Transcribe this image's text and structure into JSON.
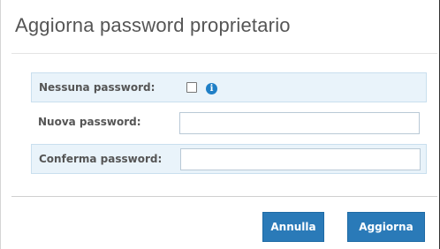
{
  "dialog": {
    "title": "Aggiorna password proprietario"
  },
  "form": {
    "no_password": {
      "label": "Nessuna password:",
      "checked": false,
      "info_icon": "info-icon",
      "info_glyph": "i"
    },
    "new_password": {
      "label": "Nuova password:",
      "value": ""
    },
    "confirm_password": {
      "label": "Conferma password:",
      "value": ""
    }
  },
  "buttons": {
    "cancel_label": "Annulla",
    "update_label": "Aggiorna"
  },
  "colors": {
    "accent": "#2a7ab8",
    "row_highlight": "#e9f3fa",
    "info_icon": "#1f7fc6"
  }
}
